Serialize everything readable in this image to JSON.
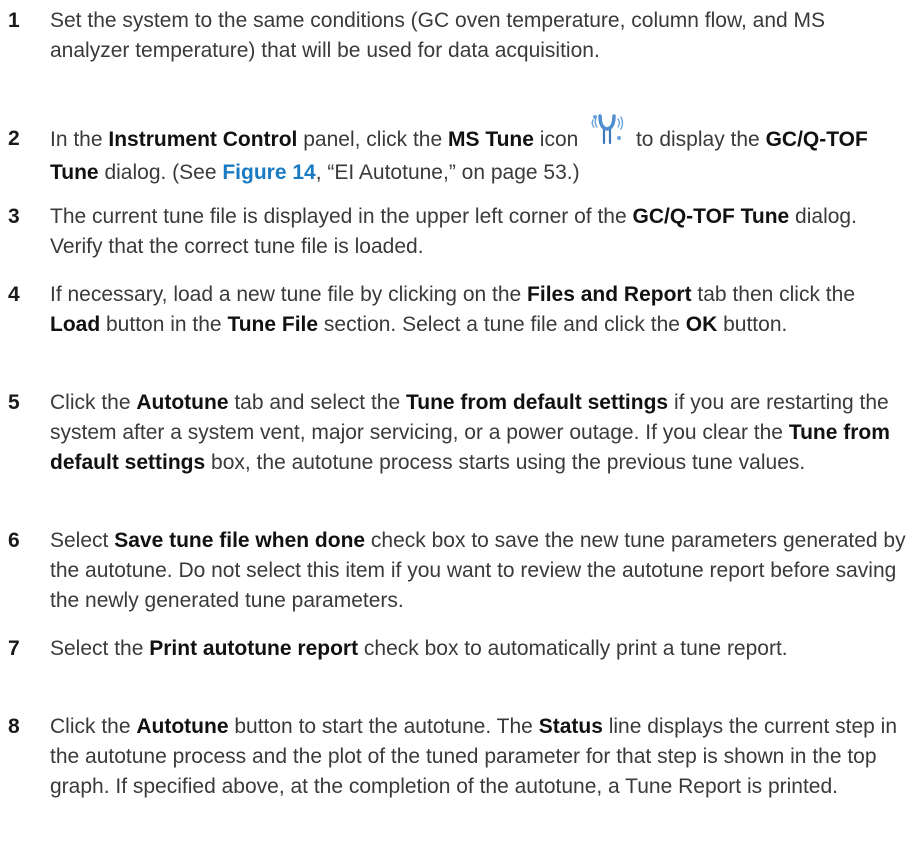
{
  "steps": [
    {
      "num": "1",
      "parts": [
        {
          "t": "Set the system to the same conditions (GC oven temperature, column flow, and MS analyzer temperature) that will be used for data acquisition."
        }
      ]
    },
    {
      "num": "2",
      "parts": [
        {
          "t": "In the "
        },
        {
          "t": "Instrument Control",
          "b": true
        },
        {
          "t": " panel, click the "
        },
        {
          "t": "MS Tune",
          "b": true
        },
        {
          "t": " icon "
        },
        {
          "icon": "ms-tune-icon"
        },
        {
          "t": " to display the "
        },
        {
          "t": "GC/Q-TOF Tune",
          "b": true
        },
        {
          "t": " dialog. (See "
        },
        {
          "t": "Figure 14",
          "link": true
        },
        {
          "t": ", “EI Autotune,” on page 53.)"
        }
      ]
    },
    {
      "num": "3",
      "parts": [
        {
          "t": "The current tune file is displayed in the upper left corner of the "
        },
        {
          "t": "GC/Q-TOF Tune",
          "b": true
        },
        {
          "t": " dialog. Verify that the correct tune file is loaded."
        }
      ]
    },
    {
      "num": "4",
      "parts": [
        {
          "t": "If necessary, load a new tune file by clicking on the "
        },
        {
          "t": "Files and Report",
          "b": true
        },
        {
          "t": " tab then click the "
        },
        {
          "t": "Load",
          "b": true
        },
        {
          "t": " button in the "
        },
        {
          "t": "Tune File",
          "b": true
        },
        {
          "t": " section. Select a tune file and click the "
        },
        {
          "t": "OK",
          "b": true
        },
        {
          "t": " button."
        }
      ]
    },
    {
      "num": "5",
      "parts": [
        {
          "t": "Click the "
        },
        {
          "t": "Autotune",
          "b": true
        },
        {
          "t": " tab and select the "
        },
        {
          "t": "Tune from default settings",
          "b": true
        },
        {
          "t": " if you are restarting the system after a system vent, major servicing, or a power outage. If you clear the "
        },
        {
          "t": "Tune from default settings",
          "b": true
        },
        {
          "t": " box, the autotune process starts using the previous tune values."
        }
      ]
    },
    {
      "num": "6",
      "parts": [
        {
          "t": "Select "
        },
        {
          "t": "Save tune file when done",
          "b": true
        },
        {
          "t": " check box to save the new tune parameters generated by the autotune. Do not select this item if you want to review the autotune report before saving the newly generated tune parameters."
        }
      ]
    },
    {
      "num": "7",
      "parts": [
        {
          "t": "Select the "
        },
        {
          "t": "Print autotune report",
          "b": true
        },
        {
          "t": " check box to automatically print a tune report."
        }
      ]
    },
    {
      "num": "8",
      "parts": [
        {
          "t": "Click the "
        },
        {
          "t": "Autotune",
          "b": true
        },
        {
          "t": " button to start the autotune. The "
        },
        {
          "t": "Status",
          "b": true
        },
        {
          "t": " line displays the current step in the autotune process and the plot of the tuned parameter for that step is shown in the top graph. If specified above, at the completion of the autotune, a Tune Report is printed."
        }
      ]
    }
  ],
  "colors": {
    "link": "#1a7ac2",
    "icon_blue": "#4f8fd0"
  }
}
